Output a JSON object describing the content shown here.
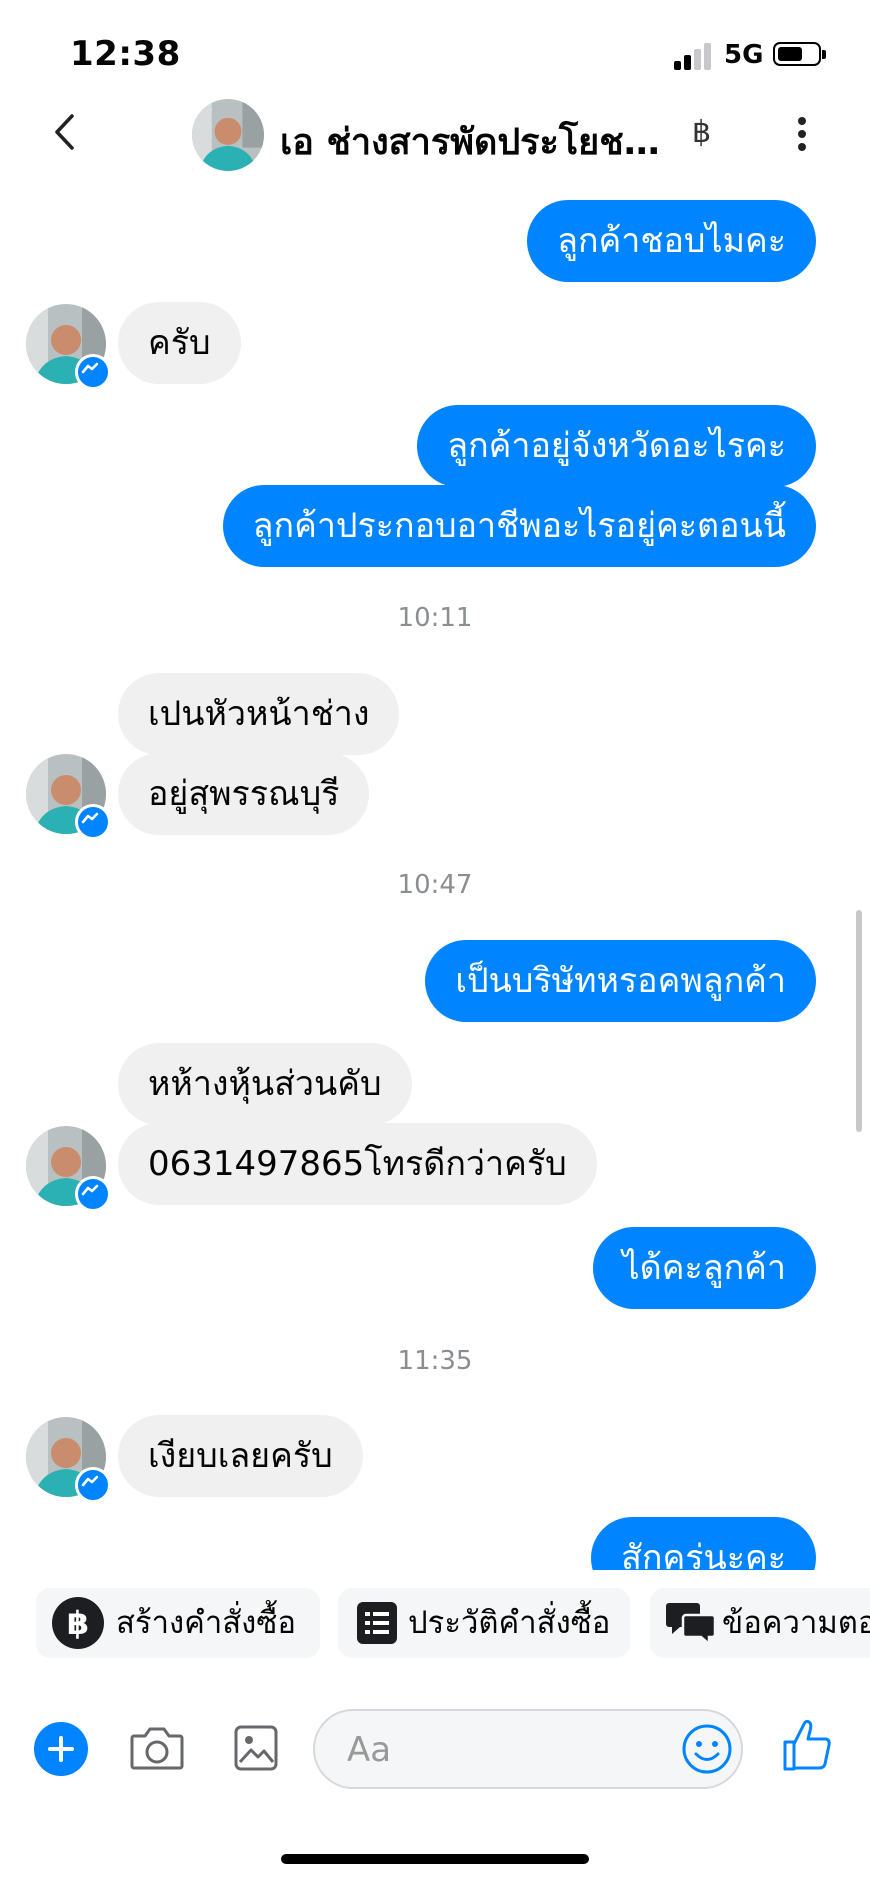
{
  "status_bar": {
    "time": "12:38",
    "network": "5G"
  },
  "header": {
    "contact_name": "เอ ช่างสารพัดประโยชน์...",
    "shop_marker": "฿"
  },
  "conversation": {
    "messages": [
      {
        "direction": "out",
        "text": "ลูกค้าชอบไมคะ"
      },
      {
        "direction": "in",
        "text": "ครับ"
      },
      {
        "direction": "out",
        "text": "ลูกค้าอยู่จังหวัดอะไรคะ"
      },
      {
        "direction": "out",
        "text": "ลูกค้าประกอบอาชีพอะไรอยู่คะตอนนี้"
      },
      {
        "direction": "in",
        "text": "เปนหัวหน้าช่าง"
      },
      {
        "direction": "in",
        "text": "อยู่สุพรรณบุรี"
      },
      {
        "direction": "out",
        "text": "เป็นบริษัทหรอคพลูกค้า"
      },
      {
        "direction": "in",
        "text": "หห้างหุ้นส่วนคับ"
      },
      {
        "direction": "in",
        "text": "0631497865โทรดีกว่าครับ"
      },
      {
        "direction": "out",
        "text": "ได้คะลูกค้า"
      },
      {
        "direction": "in",
        "text": "เงียบเลยครับ"
      },
      {
        "direction": "out",
        "text": "สักครู่นะคะ"
      }
    ],
    "timestamps": [
      "10:11",
      "10:47",
      "11:35"
    ]
  },
  "quick_actions": [
    {
      "label": "สร้างคำสั่งซื้อ",
      "icon": "baht-icon"
    },
    {
      "label": "ประวัติคำสั่งซื้อ",
      "icon": "order-list-icon"
    },
    {
      "label": "ข้อความตอบกลับ",
      "icon": "chat-bubbles-icon"
    }
  ],
  "composer": {
    "placeholder": "Aa",
    "icons": [
      "plus-icon",
      "camera-icon",
      "gallery-icon",
      "emoji-icon",
      "thumbs-up-icon"
    ]
  },
  "colors": {
    "accent": "#0084ff",
    "incoming_bubble": "#f0f0f0",
    "timestamp": "#8a8d91"
  }
}
